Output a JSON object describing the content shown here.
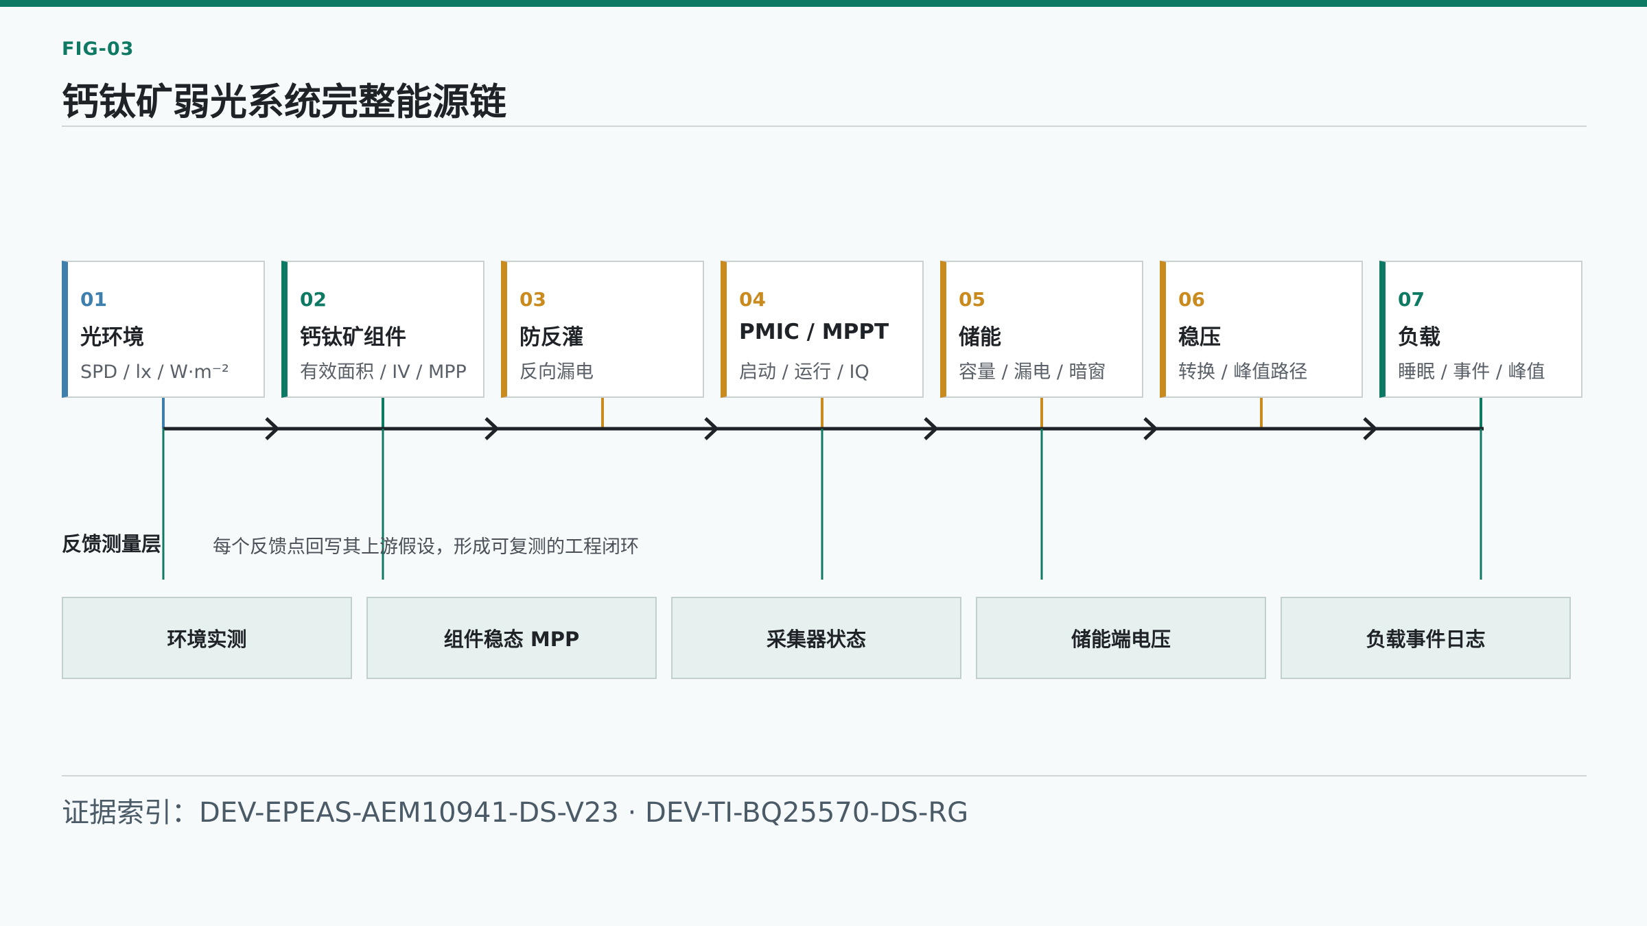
{
  "figure_label": "FIG-03",
  "title": "钙钛矿弱光系统完整能源链",
  "stages": [
    {
      "num": "01",
      "name": "光环境",
      "sub": "SPD / lx / W·m⁻²",
      "color": "#3f7fae"
    },
    {
      "num": "02",
      "name": "钙钛矿组件",
      "sub": "有效面积 / IV / MPP",
      "color": "#0e7a63"
    },
    {
      "num": "03",
      "name": "防反灌",
      "sub": "反向漏电",
      "color": "#c98a1e"
    },
    {
      "num": "04",
      "name": "PMIC / MPPT",
      "sub": "启动 / 运行 / IQ",
      "color": "#c98a1e"
    },
    {
      "num": "05",
      "name": "储能",
      "sub": "容量 / 漏电 / 暗窗",
      "color": "#c98a1e"
    },
    {
      "num": "06",
      "name": "稳压",
      "sub": "转换 / 峰值路径",
      "color": "#c98a1e"
    },
    {
      "num": "07",
      "name": "负载",
      "sub": "睡眠 / 事件 / 峰值",
      "color": "#0e7a63"
    }
  ],
  "feedback": {
    "title": "反馈测量层",
    "note": "每个反馈点回写其上游假设，形成可复测的工程闭环",
    "boxes": [
      "环境实测",
      "组件稳态 MPP",
      "采集器状态",
      "储能端电压",
      "负载事件日志"
    ]
  },
  "evidence": "证据索引：DEV-EPEAS-AEM10941-DS-V23 · DEV-TI-BQ25570-DS-RG",
  "colors": {
    "accent": "#0e7a63",
    "blue": "#3f7fae",
    "amber": "#c98a1e",
    "arrow": "#1f2328"
  }
}
